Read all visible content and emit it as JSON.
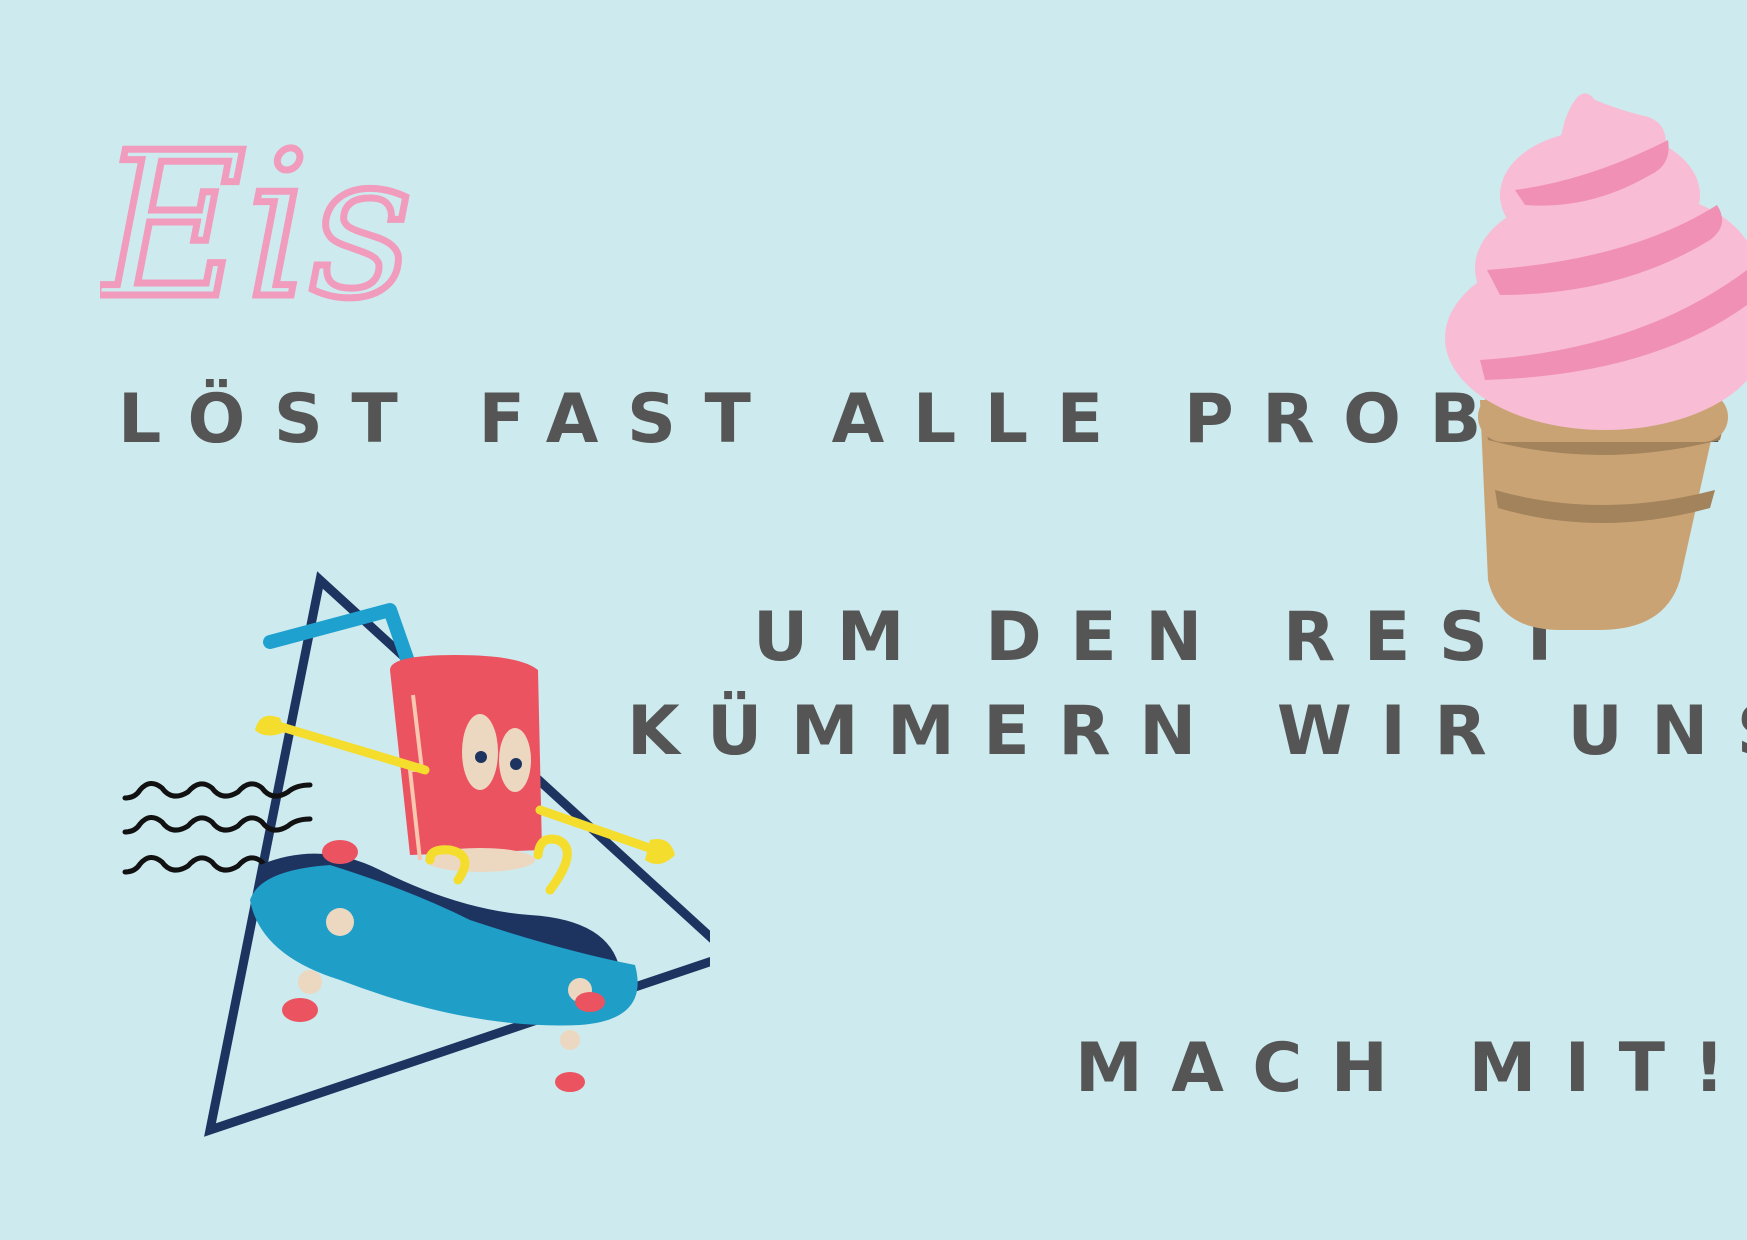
{
  "poster": {
    "script_word": "Eis",
    "headline": "LÖST FAST ALLE PROBLEME",
    "rest_line_1": "UM DEN REST",
    "rest_line_2": "KÜMMERN WIR UNS",
    "call_to_action": "MACH MIT!"
  },
  "colors": {
    "background": "#cdeaee",
    "text": "#555555",
    "script_pink": "#f19bbd",
    "cup_red": "#ec5360",
    "skateboard_blue": "#1f9ec8",
    "navy": "#1e3460",
    "icecream_pink": "#f8bcd4",
    "icecream_stripe": "#f090b4",
    "cone": "#c9a374",
    "cone_band": "#a3835b",
    "yellow": "#f5dd2d"
  },
  "icons": {
    "ice_cream": "soft-serve-ice-cream-cone-icon",
    "mascot": "soda-cup-on-skateboard-mascot",
    "waves": "squiggle-lines-icon",
    "triangle": "outline-triangle-shape"
  }
}
